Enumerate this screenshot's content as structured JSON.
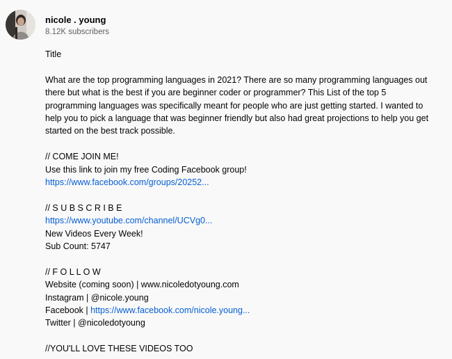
{
  "channel": {
    "avatar_icon": "channel-avatar-photo",
    "name": "nicole . young",
    "subscribers": "8.12K subscribers"
  },
  "description": {
    "title_line": "Title",
    "intro": "What are the top programming languages in 2021? There are so many programming languages out there but what is the best if you are beginner coder or programmer? This List of the top 5 programming languages was specifically meant for people who are just getting started. I wanted to help you to pick a language that was beginner friendly but also had great projections to help you get started on the best track possible.",
    "join": {
      "heading": "// COME JOIN ME!",
      "text": "Use this link to join my free Coding Facebook group!",
      "link": "https://www.facebook.com/groups/20252..."
    },
    "subscribe": {
      "heading": "// S U B S C R I B E",
      "link": "https://www.youtube.com/channel/UCVg0...",
      "new_videos": "New Videos Every Week!",
      "sub_count": "Sub Count: 5747"
    },
    "follow": {
      "heading": "// F O L L O W",
      "website": "Website (coming soon) | www.nicoledotyoung.com",
      "instagram": "Instagram | @nicole.young",
      "facebook_label": "Facebook | ",
      "facebook_link": "https://www.facebook.com/nicole.young...",
      "twitter": "Twitter | @nicoledotyoung"
    },
    "love_videos": "//YOU'LL LOVE THESE VIDEOS TOO"
  },
  "colors": {
    "background": "#f9f9f9",
    "text": "#030303",
    "secondary_text": "#606060",
    "link": "#065fd4"
  }
}
